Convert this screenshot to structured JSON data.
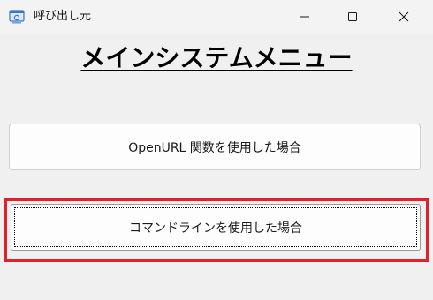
{
  "window": {
    "title": "呼び出し元",
    "app_icon": "form-window-icon",
    "controls": {
      "minimize_icon": "minimize-icon",
      "maximize_icon": "maximize-icon",
      "close_icon": "close-icon"
    }
  },
  "main": {
    "heading": "メインシステムメニュー",
    "buttons": {
      "openurl_label": "OpenURL 関数を使用した場合",
      "cmdline_label": "コマンドラインを使用した場合"
    }
  },
  "colors": {
    "highlight": "#e0202a",
    "window_bg": "#f0f0f0"
  }
}
